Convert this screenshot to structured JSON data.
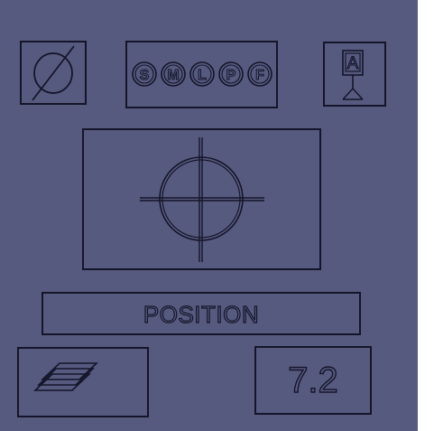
{
  "buttons": {
    "diameter": {
      "icon": "diameter-icon"
    },
    "sizes": {
      "icon": "size-selector-icon",
      "letters": [
        "S",
        "M",
        "L",
        "P",
        "F"
      ]
    },
    "text_marker": {
      "icon": "text-marker-stand-icon",
      "letter": "A"
    },
    "layers": {
      "icon": "layers-icon"
    }
  },
  "viewport": {
    "icon": "crosshair-icon"
  },
  "position_label": "POSITION",
  "value_display": "7.2",
  "colors": {
    "background": "#575a7f",
    "outline": "#14152a",
    "edge": "#ffffff"
  }
}
